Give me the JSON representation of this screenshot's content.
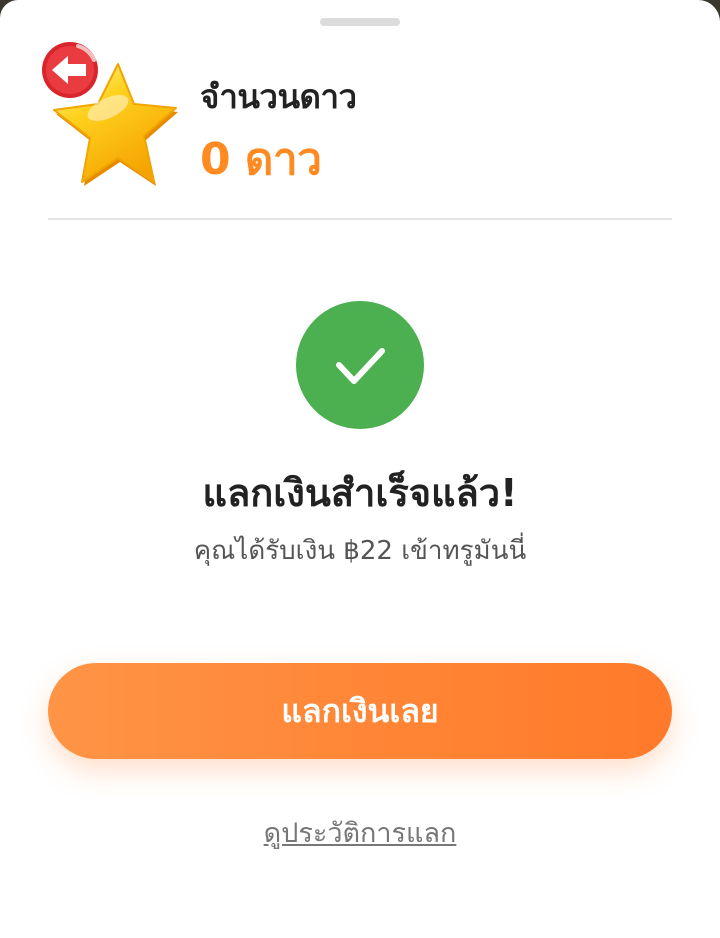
{
  "header": {
    "title": "จำนวนดาว",
    "count": "0 ดาว",
    "star_icon": "star-icon",
    "back_icon": "arrow-left-icon"
  },
  "status": {
    "icon": "check-icon",
    "title": "แลกเงินสำเร็จแล้ว!",
    "message": "คุณได้รับเงิน ฿22 เข้าทรูมันนี่"
  },
  "actions": {
    "redeem_label": "แลกเงินเลย",
    "history_link": "ดูประวัติการแลก"
  },
  "colors": {
    "accent": "#ff8a22",
    "success": "#4caf50",
    "back_button": "#d9262c",
    "button_gradient_start": "#ff9446",
    "button_gradient_end": "#ff7a2a"
  }
}
